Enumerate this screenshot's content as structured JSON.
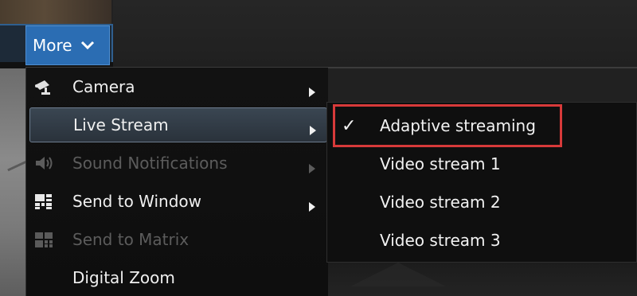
{
  "toolbar": {
    "more_label": "More",
    "more_icon": "chevron-down-icon"
  },
  "menu": {
    "items": [
      {
        "label": "Camera",
        "icon": "camera-icon",
        "has_submenu": true,
        "enabled": true
      },
      {
        "label": "Live Stream",
        "icon": "",
        "has_submenu": true,
        "enabled": true,
        "active": true
      },
      {
        "label": "Sound Notifications",
        "icon": "speaker-icon",
        "has_submenu": true,
        "enabled": false
      },
      {
        "label": "Send to Window",
        "icon": "window-grid-icon",
        "has_submenu": true,
        "enabled": true
      },
      {
        "label": "Send to Matrix",
        "icon": "matrix-grid-icon",
        "has_submenu": false,
        "enabled": false
      },
      {
        "label": "Digital Zoom",
        "icon": "",
        "has_submenu": false,
        "enabled": true
      }
    ]
  },
  "submenu": {
    "items": [
      {
        "label": "Adaptive streaming",
        "checked": true,
        "check_glyph": "✓"
      },
      {
        "label": "Video stream 1",
        "checked": false
      },
      {
        "label": "Video stream 2",
        "checked": false
      },
      {
        "label": "Video stream 3",
        "checked": false
      }
    ]
  },
  "colors": {
    "accent": "#2b6db3",
    "highlight": "#d83a3a",
    "menu_bg": "#0f0f0f",
    "disabled_text": "#5c5c5c"
  }
}
